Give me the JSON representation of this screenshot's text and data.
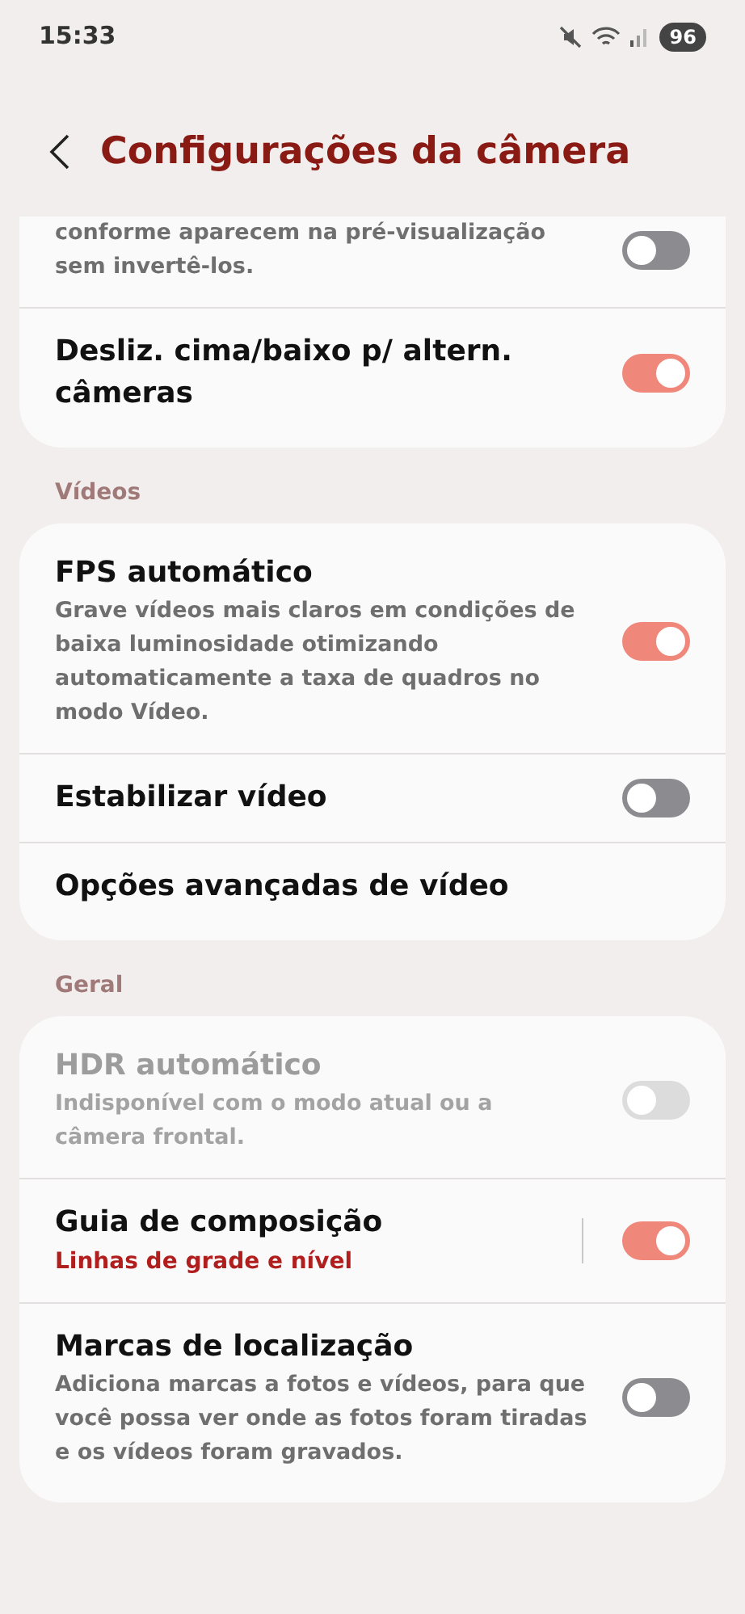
{
  "status_bar": {
    "time": "15:33",
    "battery": "96"
  },
  "header": {
    "title": "Configurações da câmera"
  },
  "groups": [
    {
      "items": [
        {
          "kind": "switch",
          "description": "conforme aparecem na pré-visualização sem invertê-los.",
          "on": false,
          "disabled": false
        },
        {
          "kind": "switch",
          "title": "Desliz. cima/baixo p/ altern. câmeras",
          "on": true,
          "disabled": false
        }
      ]
    },
    {
      "header": "Vídeos",
      "items": [
        {
          "kind": "switch",
          "title": "FPS automático",
          "description": "Grave vídeos mais claros em condições de baixa luminosidade otimizando automaticamente a taxa de quadros no modo Vídeo.",
          "on": true,
          "disabled": false
        },
        {
          "kind": "switch",
          "title": "Estabilizar vídeo",
          "on": false,
          "disabled": false
        },
        {
          "kind": "link",
          "title": "Opções avançadas de vídeo"
        }
      ]
    },
    {
      "header": "Geral",
      "items": [
        {
          "kind": "switch",
          "title": "HDR automático",
          "description": "Indisponível com o modo atual ou a câmera frontal.",
          "on": false,
          "disabled": true
        },
        {
          "kind": "split-switch",
          "title": "Guia de composição",
          "value": "Linhas de grade e nível",
          "on": true,
          "disabled": false
        },
        {
          "kind": "switch",
          "title": "Marcas de localização",
          "description": "Adiciona marcas a fotos e vídeos, para que você possa ver onde as fotos foram tiradas e os vídeos foram gravados.",
          "on": false,
          "disabled": false
        }
      ]
    }
  ]
}
